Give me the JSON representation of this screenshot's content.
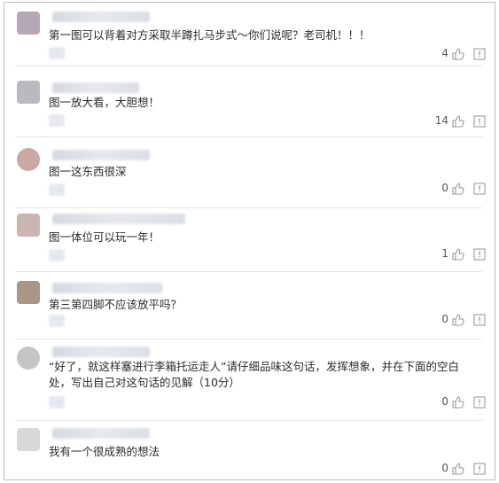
{
  "comments": [
    {
      "text": "第一图可以背着对方采取半蹲扎马步式～你们说呢？老司机！！！",
      "likes": "4",
      "avatar_color": "#b7a7b4"
    },
    {
      "text": "图一放大看，大胆想！",
      "likes": "14",
      "avatar_color": "#b9b9bf"
    },
    {
      "text": "图一这东西很深",
      "likes": "0",
      "avatar_color": "#caa9a5"
    },
    {
      "text": "图一体位可以玩一年！",
      "likes": "1",
      "avatar_color": "#c9b6b2"
    },
    {
      "text": "第三第四脚不应该放平吗？",
      "likes": "0",
      "avatar_color": "#a99684"
    },
    {
      "text": "“好了，就这样塞进行李箱托运走人”请仔细品味这句话，发挥想象，并在下面的空白处，写出自己对这句话的见解（10分）",
      "likes": "0",
      "avatar_color": "#c4c6c6"
    },
    {
      "text": "我有一个很成熟的想法",
      "likes": "0",
      "avatar_color": "#d8d8d8"
    }
  ],
  "icons": {
    "like": "thumbs-up-icon",
    "report": "report-icon"
  }
}
